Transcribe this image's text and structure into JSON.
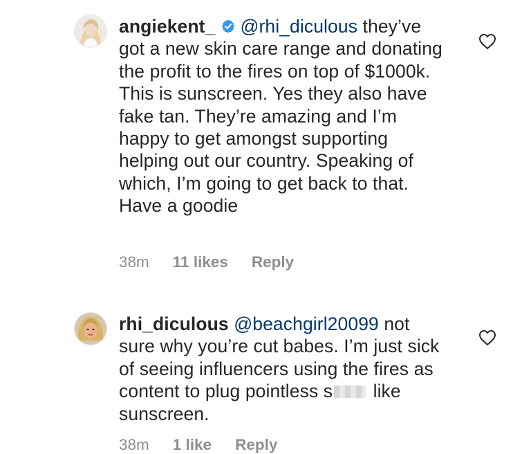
{
  "comments": [
    {
      "username": "angiekent_",
      "verified": true,
      "mention": "@rhi_diculous",
      "text_before_censor": " they’ve got a new skin care range and donating the profit to the fires on top of $1000k. This is sunscreen. Yes they also have fake tan. They’re amazing and I’m happy to get amongst supporting helping out our country. Speaking of which, I’m going to get back to that. Have a goodie",
      "time": "38m",
      "likes": "11 likes",
      "reply_label": "Reply",
      "icons": {
        "like": "heart-outline-icon",
        "verified": "verified-badge-icon"
      }
    },
    {
      "username": "rhi_diculous",
      "verified": false,
      "mention": "@beachgirl20099",
      "text_before_censor": " not sure why you’re cut babes. I’m just sick of seeing influencers using the fires as content to plug pointless s",
      "text_after_censor": " like sunscreen.",
      "time": "38m",
      "likes": "1 like",
      "reply_label": "Reply",
      "icons": {
        "like": "heart-outline-icon"
      }
    }
  ],
  "colors": {
    "mention": "#00376b",
    "meta": "#8e8e8e",
    "verified": "#3897f0",
    "text": "#262626"
  }
}
